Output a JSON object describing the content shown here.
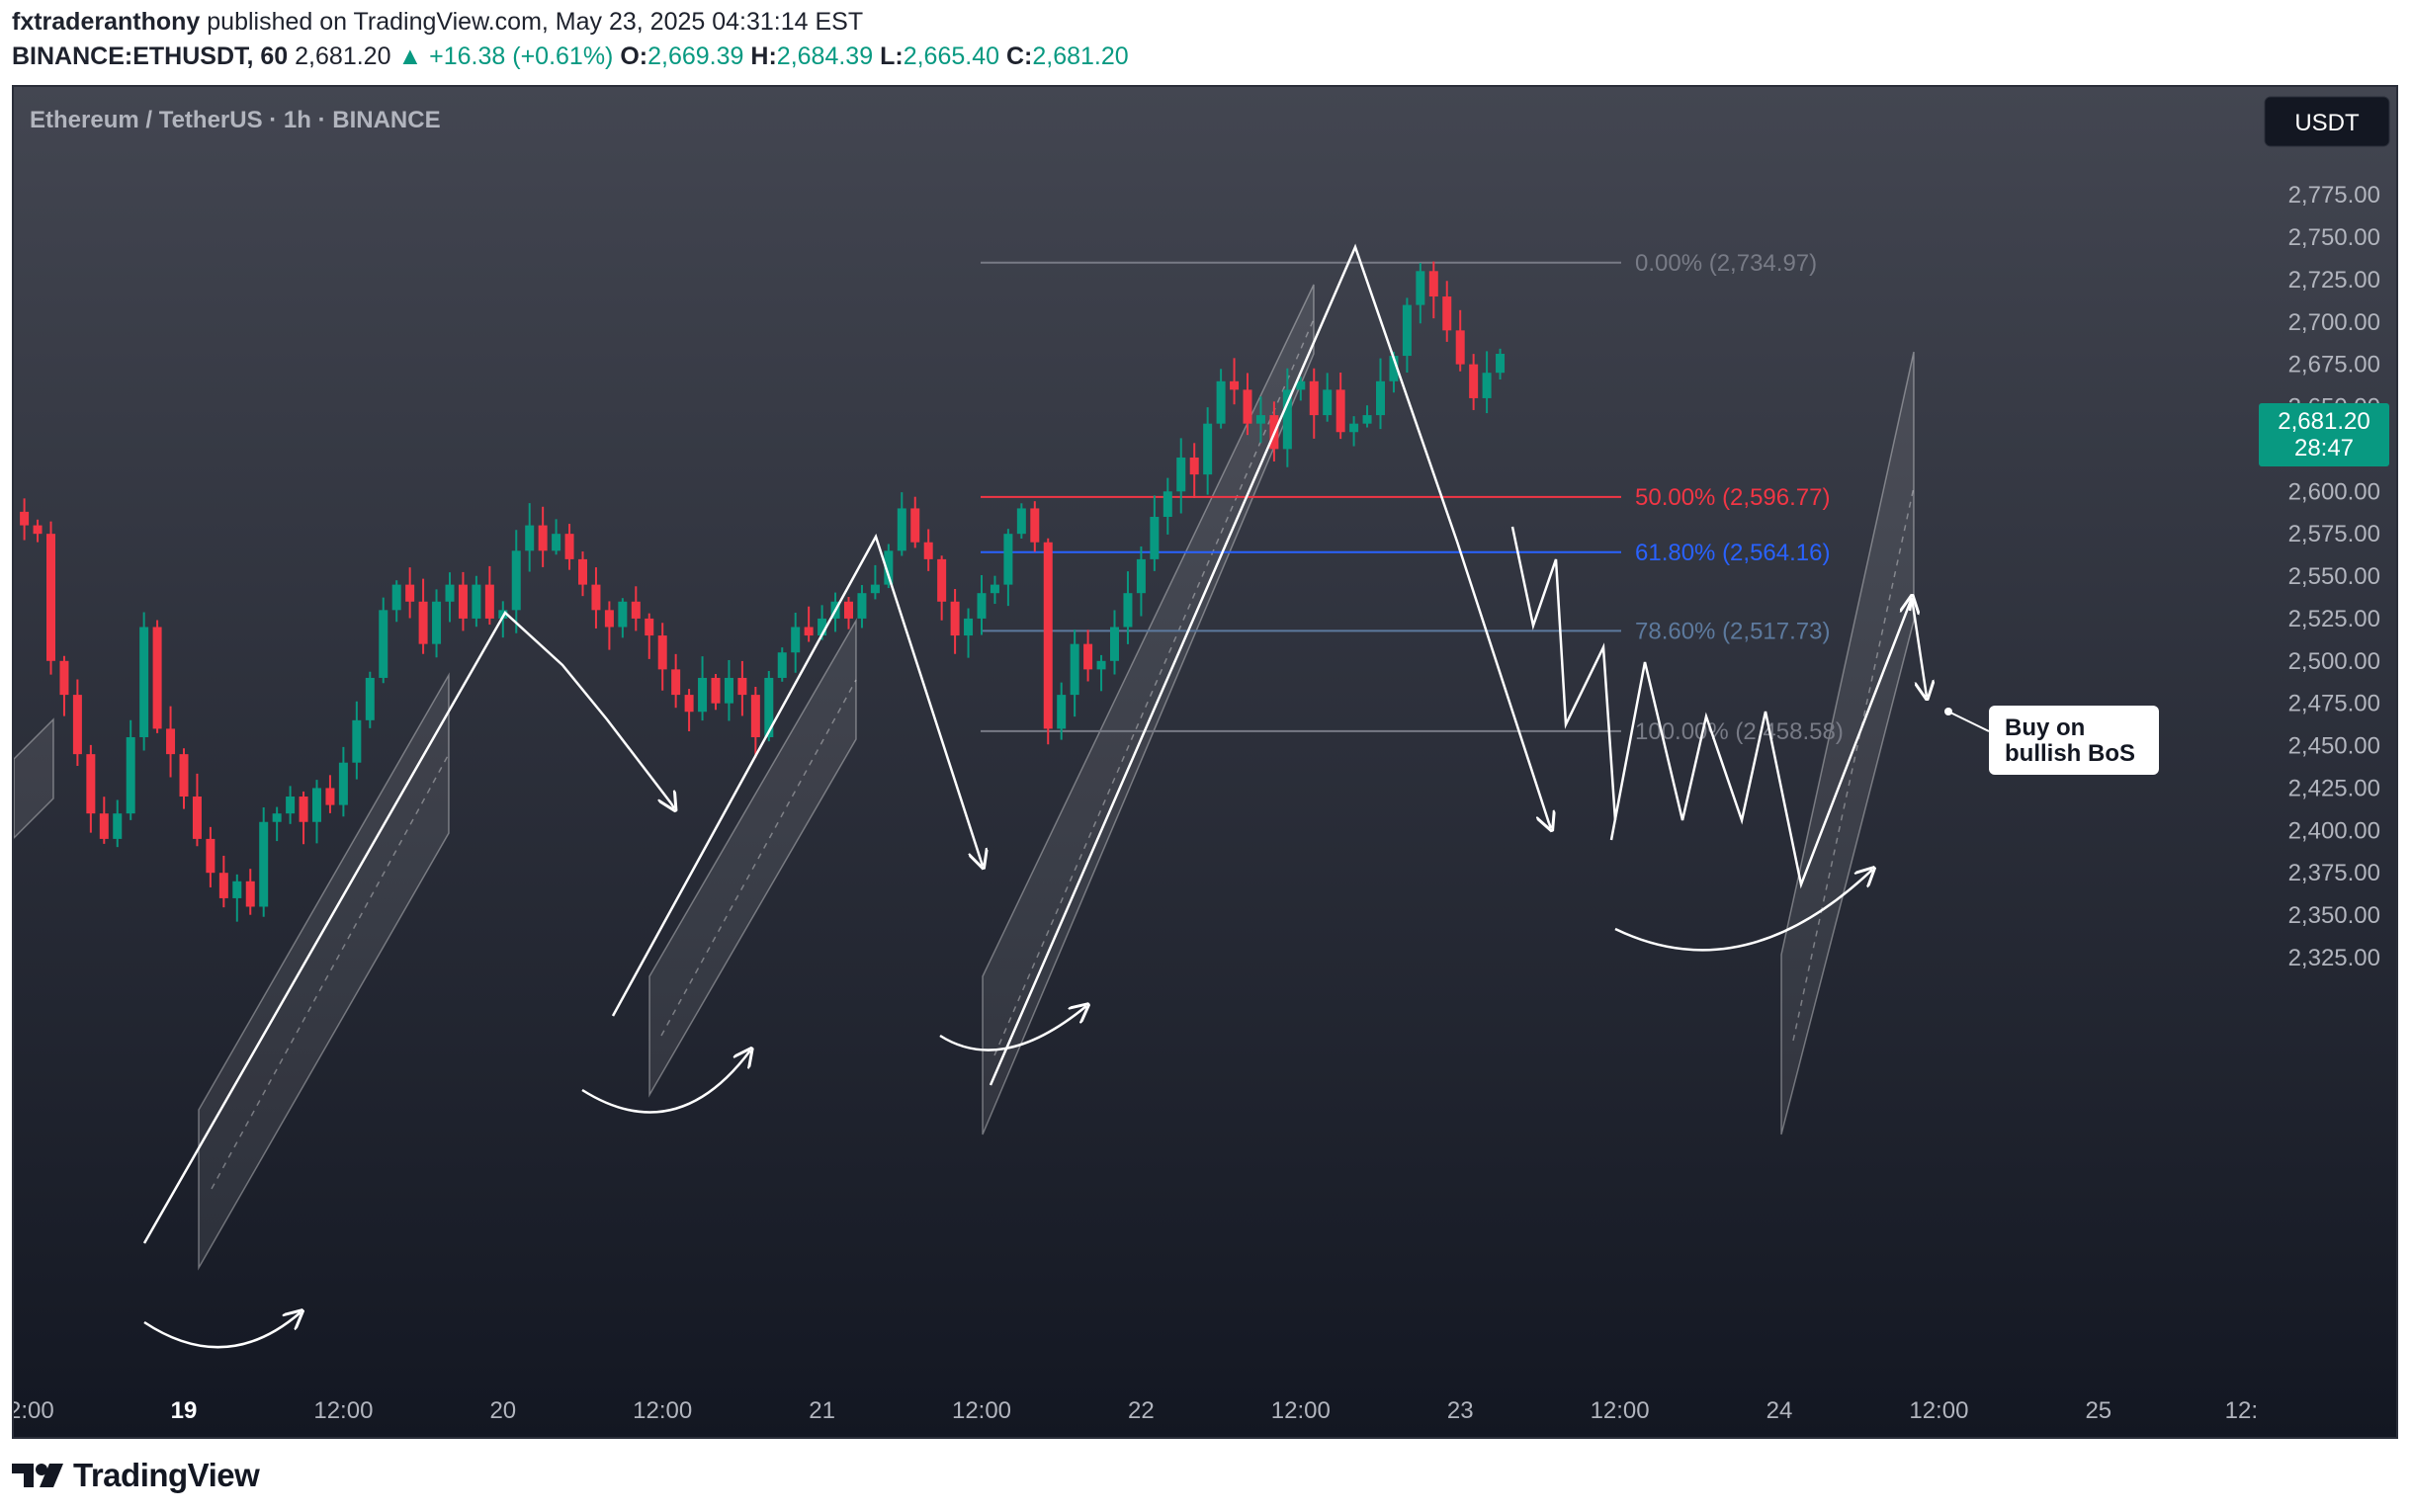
{
  "header": {
    "author": "fxtraderanthony",
    "published_text": "published on TradingView.com, May 23, 2025 04:31:14 EST",
    "symbol": "BINANCE:ETHUSDT, 60",
    "last_price": "2,681.20",
    "change": "+16.38 (+0.61%)",
    "ohlc": [
      {
        "label": "O:",
        "value": "2,669.39"
      },
      {
        "label": "H:",
        "value": "2,684.39"
      },
      {
        "label": "L:",
        "value": "2,665.40"
      },
      {
        "label": "C:",
        "value": "2,681.20"
      }
    ]
  },
  "legend": {
    "title": "Ethereum / TetherUS · 1h · BINANCE"
  },
  "currency_button": "USDT",
  "price_badge": {
    "price": "2,681.20",
    "countdown": "28:47"
  },
  "annotation": {
    "line1": "Buy on",
    "line2": "bullish BoS"
  },
  "footer": {
    "brand": "TradingView"
  },
  "colors": {
    "up": "#089981",
    "down": "#f23645",
    "bg_top": "#434651",
    "bg_bottom": "#131722"
  },
  "chart_data": {
    "type": "candlestick",
    "symbol": "ETHUSDT",
    "timeframe": "1h",
    "y_range": [
      2310,
      2795
    ],
    "x_range_hours": [
      -12,
      148
    ],
    "y_ticks": [
      2775,
      2750,
      2725,
      2700,
      2675,
      2650,
      2625,
      2600,
      2575,
      2550,
      2525,
      2500,
      2475,
      2450,
      2425,
      2400,
      2375,
      2350,
      2325
    ],
    "y_tick_labels": [
      "2,775.00",
      "2,750.00",
      "2,725.00",
      "2,700.00",
      "2,675.00",
      "2,650.00",
      "2,625.00",
      "2,600.00",
      "2,575.00",
      "2,550.00",
      "2,525.00",
      "2,500.00",
      "2,475.00",
      "2,450.00",
      "2,425.00",
      "2,400.00",
      "2,375.00",
      "2,350.00",
      "2,325.00"
    ],
    "x_ticks": [
      {
        "h": -12,
        "label": "2:00",
        "bold": false
      },
      {
        "h": 0,
        "label": "19",
        "bold": true
      },
      {
        "h": 12,
        "label": "12:00",
        "bold": false
      },
      {
        "h": 24,
        "label": "20",
        "bold": false
      },
      {
        "h": 36,
        "label": "12:00",
        "bold": false
      },
      {
        "h": 48,
        "label": "21",
        "bold": false
      },
      {
        "h": 60,
        "label": "12:00",
        "bold": false
      },
      {
        "h": 72,
        "label": "22",
        "bold": false
      },
      {
        "h": 84,
        "label": "12:00",
        "bold": false
      },
      {
        "h": 96,
        "label": "23",
        "bold": false
      },
      {
        "h": 108,
        "label": "12:00",
        "bold": false
      },
      {
        "h": 120,
        "label": "24",
        "bold": false
      },
      {
        "h": 132,
        "label": "12:00",
        "bold": false
      },
      {
        "h": 144,
        "label": "25",
        "bold": false
      },
      {
        "h": 156,
        "label": "12:",
        "bold": false
      }
    ],
    "candles_anchor_close": [
      [
        -12,
        2580
      ],
      [
        -11,
        2575
      ],
      [
        -10,
        2500
      ],
      [
        -9,
        2480
      ],
      [
        -8,
        2445
      ],
      [
        -7,
        2410
      ],
      [
        -6,
        2395
      ],
      [
        -5,
        2410
      ],
      [
        -4,
        2455
      ],
      [
        -3,
        2520
      ],
      [
        -2,
        2460
      ],
      [
        -1,
        2445
      ],
      [
        0,
        2420
      ],
      [
        1,
        2395
      ],
      [
        2,
        2375
      ],
      [
        3,
        2360
      ],
      [
        4,
        2370
      ],
      [
        5,
        2355
      ],
      [
        6,
        2405
      ],
      [
        7,
        2410
      ],
      [
        8,
        2420
      ],
      [
        9,
        2405
      ],
      [
        10,
        2425
      ],
      [
        11,
        2415
      ],
      [
        12,
        2440
      ],
      [
        13,
        2465
      ],
      [
        14,
        2490
      ],
      [
        15,
        2530
      ],
      [
        16,
        2545
      ],
      [
        17,
        2535
      ],
      [
        18,
        2510
      ],
      [
        19,
        2535
      ],
      [
        20,
        2545
      ],
      [
        21,
        2525
      ],
      [
        22,
        2545
      ],
      [
        23,
        2525
      ],
      [
        24,
        2530
      ],
      [
        25,
        2565
      ],
      [
        26,
        2580
      ],
      [
        27,
        2565
      ],
      [
        28,
        2575
      ],
      [
        29,
        2560
      ],
      [
        30,
        2545
      ],
      [
        31,
        2530
      ],
      [
        32,
        2520
      ],
      [
        33,
        2535
      ],
      [
        34,
        2525
      ],
      [
        35,
        2515
      ],
      [
        36,
        2495
      ],
      [
        37,
        2480
      ],
      [
        38,
        2470
      ],
      [
        39,
        2490
      ],
      [
        40,
        2475
      ],
      [
        41,
        2490
      ],
      [
        42,
        2480
      ],
      [
        43,
        2455
      ],
      [
        44,
        2490
      ],
      [
        45,
        2505
      ],
      [
        46,
        2520
      ],
      [
        47,
        2515
      ],
      [
        48,
        2525
      ],
      [
        49,
        2535
      ],
      [
        50,
        2525
      ],
      [
        51,
        2540
      ],
      [
        52,
        2545
      ],
      [
        53,
        2565
      ],
      [
        54,
        2590
      ],
      [
        55,
        2570
      ],
      [
        56,
        2560
      ],
      [
        57,
        2535
      ],
      [
        58,
        2515
      ],
      [
        59,
        2525
      ],
      [
        60,
        2540
      ],
      [
        61,
        2545
      ],
      [
        62,
        2575
      ],
      [
        63,
        2590
      ],
      [
        64,
        2570
      ],
      [
        65,
        2460
      ],
      [
        66,
        2480
      ],
      [
        67,
        2510
      ],
      [
        68,
        2495
      ],
      [
        69,
        2500
      ],
      [
        70,
        2520
      ],
      [
        71,
        2540
      ],
      [
        72,
        2560
      ],
      [
        73,
        2585
      ],
      [
        74,
        2600
      ],
      [
        75,
        2620
      ],
      [
        76,
        2610
      ],
      [
        77,
        2640
      ],
      [
        78,
        2665
      ],
      [
        79,
        2660
      ],
      [
        80,
        2640
      ],
      [
        81,
        2645
      ],
      [
        82,
        2625
      ],
      [
        83,
        2660
      ],
      [
        84,
        2665
      ],
      [
        85,
        2645
      ],
      [
        86,
        2660
      ],
      [
        87,
        2635
      ],
      [
        88,
        2640
      ],
      [
        89,
        2645
      ],
      [
        90,
        2665
      ],
      [
        91,
        2680
      ],
      [
        92,
        2710
      ],
      [
        93,
        2730
      ],
      [
        94,
        2715
      ],
      [
        95,
        2695
      ],
      [
        96,
        2675
      ],
      [
        97,
        2655
      ],
      [
        98,
        2670
      ],
      [
        99,
        2681.2
      ]
    ],
    "fibonacci": [
      {
        "level": "0.00%",
        "price": 2734.97,
        "label": "0.00% (2,734.97)",
        "color": "#787b86"
      },
      {
        "level": "50.00%",
        "price": 2596.77,
        "label": "50.00% (2,596.77)",
        "color": "#f23645"
      },
      {
        "level": "61.80%",
        "price": 2564.16,
        "label": "61.80% (2,564.16)",
        "color": "#2962ff"
      },
      {
        "level": "78.60%",
        "price": 2517.73,
        "label": "78.60% (2,517.73)",
        "color": "#5d7a9e"
      },
      {
        "level": "100.00%",
        "price": 2458.58,
        "label": "100.00% (2,458.58)",
        "color": "#787b86"
      }
    ]
  }
}
